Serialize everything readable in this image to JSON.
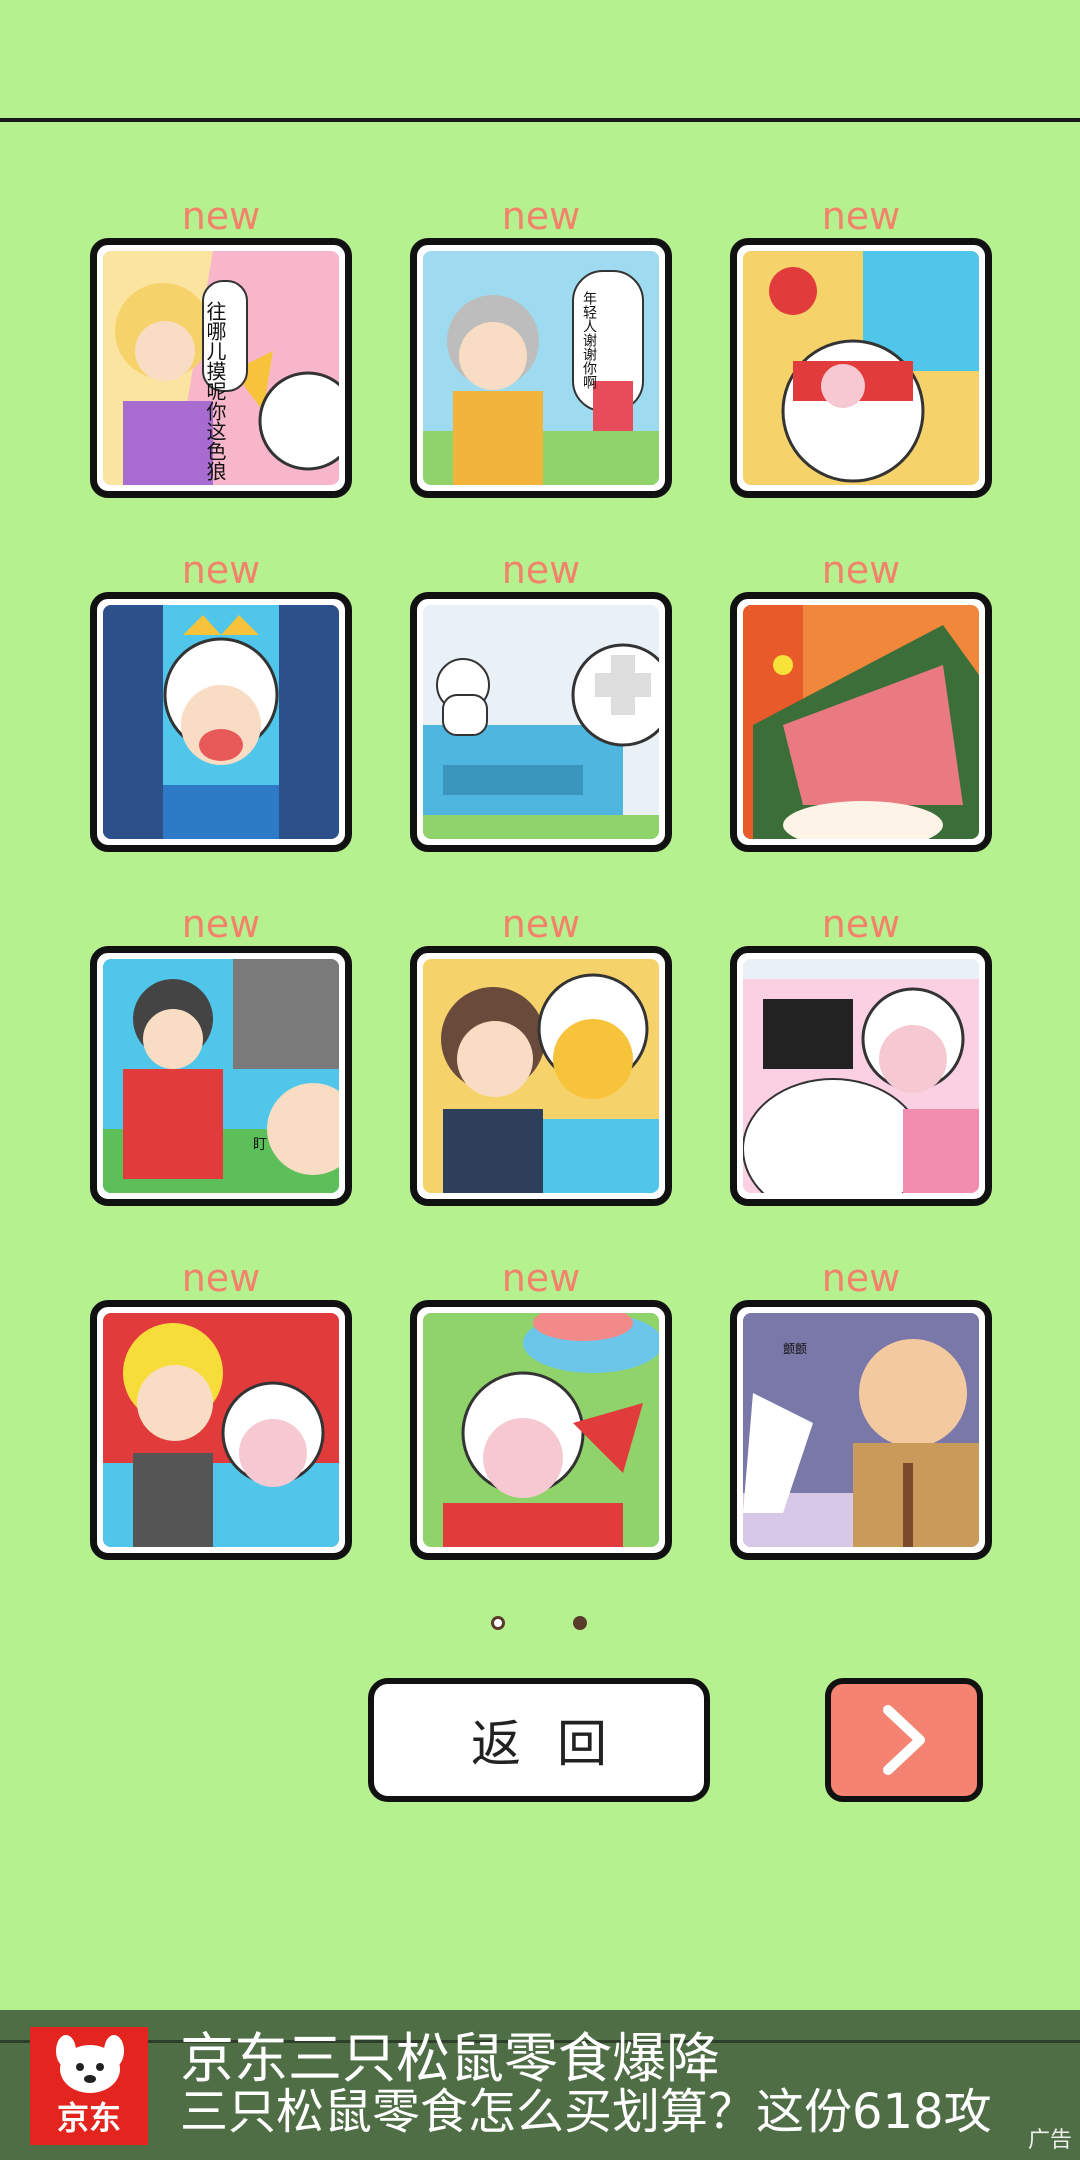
{
  "levels": [
    {
      "badge": "new",
      "bubble": "往哪儿摸呢你这色狼"
    },
    {
      "badge": "new",
      "bubble": "年轻人谢谢你啊"
    },
    {
      "badge": "new"
    },
    {
      "badge": "new"
    },
    {
      "badge": "new"
    },
    {
      "badge": "new"
    },
    {
      "badge": "new",
      "bubble": "盯"
    },
    {
      "badge": "new"
    },
    {
      "badge": "new"
    },
    {
      "badge": "new"
    },
    {
      "badge": "new"
    },
    {
      "badge": "new",
      "bubble": "颤颤"
    }
  ],
  "pagination": {
    "pages": 2,
    "current": 2
  },
  "buttons": {
    "back_label": "返回",
    "next_icon": "chevron-right-icon"
  },
  "ad": {
    "logo_text": "京东",
    "title": "京东三只松鼠零食爆降",
    "subtitle": "三只松鼠零食怎么买划算？这份618攻",
    "tag": "广告"
  },
  "colors": {
    "background": "#b6f18f",
    "badge": "#f2836a",
    "next_button": "#f48372",
    "ad_bar": "#4f6e46"
  }
}
